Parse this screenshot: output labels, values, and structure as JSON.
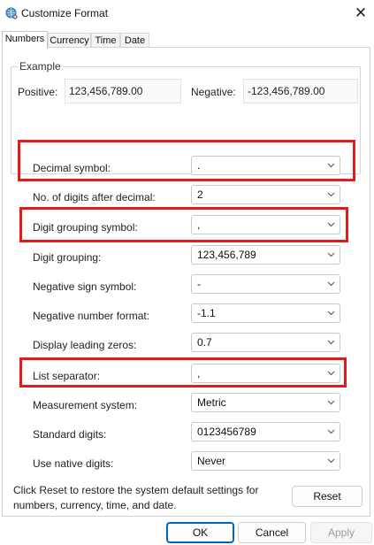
{
  "window": {
    "title": "Customize Format",
    "close_icon": "close-icon",
    "app_icon": "globe-settings-icon"
  },
  "tabs": [
    {
      "label": "Numbers",
      "active": true
    },
    {
      "label": "Currency",
      "active": false
    },
    {
      "label": "Time",
      "active": false
    },
    {
      "label": "Date",
      "active": false
    }
  ],
  "example": {
    "legend": "Example",
    "positive_label": "Positive:",
    "positive_value": "123,456,789.00",
    "negative_label": "Negative:",
    "negative_value": "-123,456,789.00"
  },
  "fields": [
    {
      "label": "Decimal symbol:",
      "value": ".",
      "highlighted": true
    },
    {
      "label": "No. of digits after decimal:",
      "value": "2",
      "highlighted": false
    },
    {
      "label": "Digit grouping symbol:",
      "value": ",",
      "highlighted": true
    },
    {
      "label": "Digit grouping:",
      "value": "123,456,789",
      "highlighted": false
    },
    {
      "label": "Negative sign symbol:",
      "value": "-",
      "highlighted": false
    },
    {
      "label": "Negative number format:",
      "value": "-1.1",
      "highlighted": false
    },
    {
      "label": "Display leading zeros:",
      "value": "0.7",
      "highlighted": false
    },
    {
      "label": "List separator:",
      "value": ",",
      "highlighted": true
    },
    {
      "label": "Measurement system:",
      "value": "Metric",
      "highlighted": false
    },
    {
      "label": "Standard digits:",
      "value": "0123456789",
      "highlighted": false
    },
    {
      "label": "Use native digits:",
      "value": "Never",
      "highlighted": false
    }
  ],
  "reset_note": "Click Reset to restore the system default settings for numbers, currency, time, and date.",
  "buttons": {
    "reset": "Reset",
    "ok": "OK",
    "cancel": "Cancel",
    "apply": "Apply"
  },
  "colors": {
    "highlight": "#e21b1b",
    "primary_border": "#0067c0"
  }
}
